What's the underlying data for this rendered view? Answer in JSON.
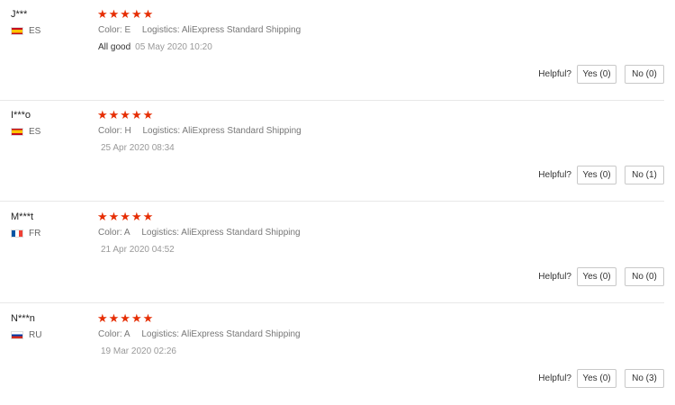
{
  "reviews": [
    {
      "user": "J***",
      "country_code": "ES",
      "flag_icon": "spain-flag-icon",
      "stars": "★★★★★",
      "color_label": "Color:",
      "color_value": "E",
      "logistics_label": "Logistics:",
      "logistics_value": "AliExpress Standard Shipping",
      "text": "All good",
      "date": "05 May 2020 10:20",
      "helpful_label": "Helpful?",
      "yes_label": "Yes (0)",
      "no_label": "No (0)"
    },
    {
      "user": "I***o",
      "country_code": "ES",
      "flag_icon": "spain-flag-icon",
      "stars": "★★★★★",
      "color_label": "Color:",
      "color_value": "H",
      "logistics_label": "Logistics:",
      "logistics_value": "AliExpress Standard Shipping",
      "text": "",
      "date": "25 Apr 2020 08:34",
      "helpful_label": "Helpful?",
      "yes_label": "Yes (0)",
      "no_label": "No (1)"
    },
    {
      "user": "M***t",
      "country_code": "FR",
      "flag_icon": "france-flag-icon",
      "stars": "★★★★★",
      "color_label": "Color:",
      "color_value": "A",
      "logistics_label": "Logistics:",
      "logistics_value": "AliExpress Standard Shipping",
      "text": "",
      "date": "21 Apr 2020 04:52",
      "helpful_label": "Helpful?",
      "yes_label": "Yes (0)",
      "no_label": "No (0)"
    },
    {
      "user": "N***n",
      "country_code": "RU",
      "flag_icon": "russia-flag-icon",
      "stars": "★★★★★",
      "color_label": "Color:",
      "color_value": "A",
      "logistics_label": "Logistics:",
      "logistics_value": "AliExpress Standard Shipping",
      "text": "",
      "date": "19 Mar 2020 02:26",
      "helpful_label": "Helpful?",
      "yes_label": "Yes (0)",
      "no_label": "No (3)"
    }
  ],
  "colors": {
    "star": "#e62e04",
    "divider": "#e8e8e8"
  }
}
